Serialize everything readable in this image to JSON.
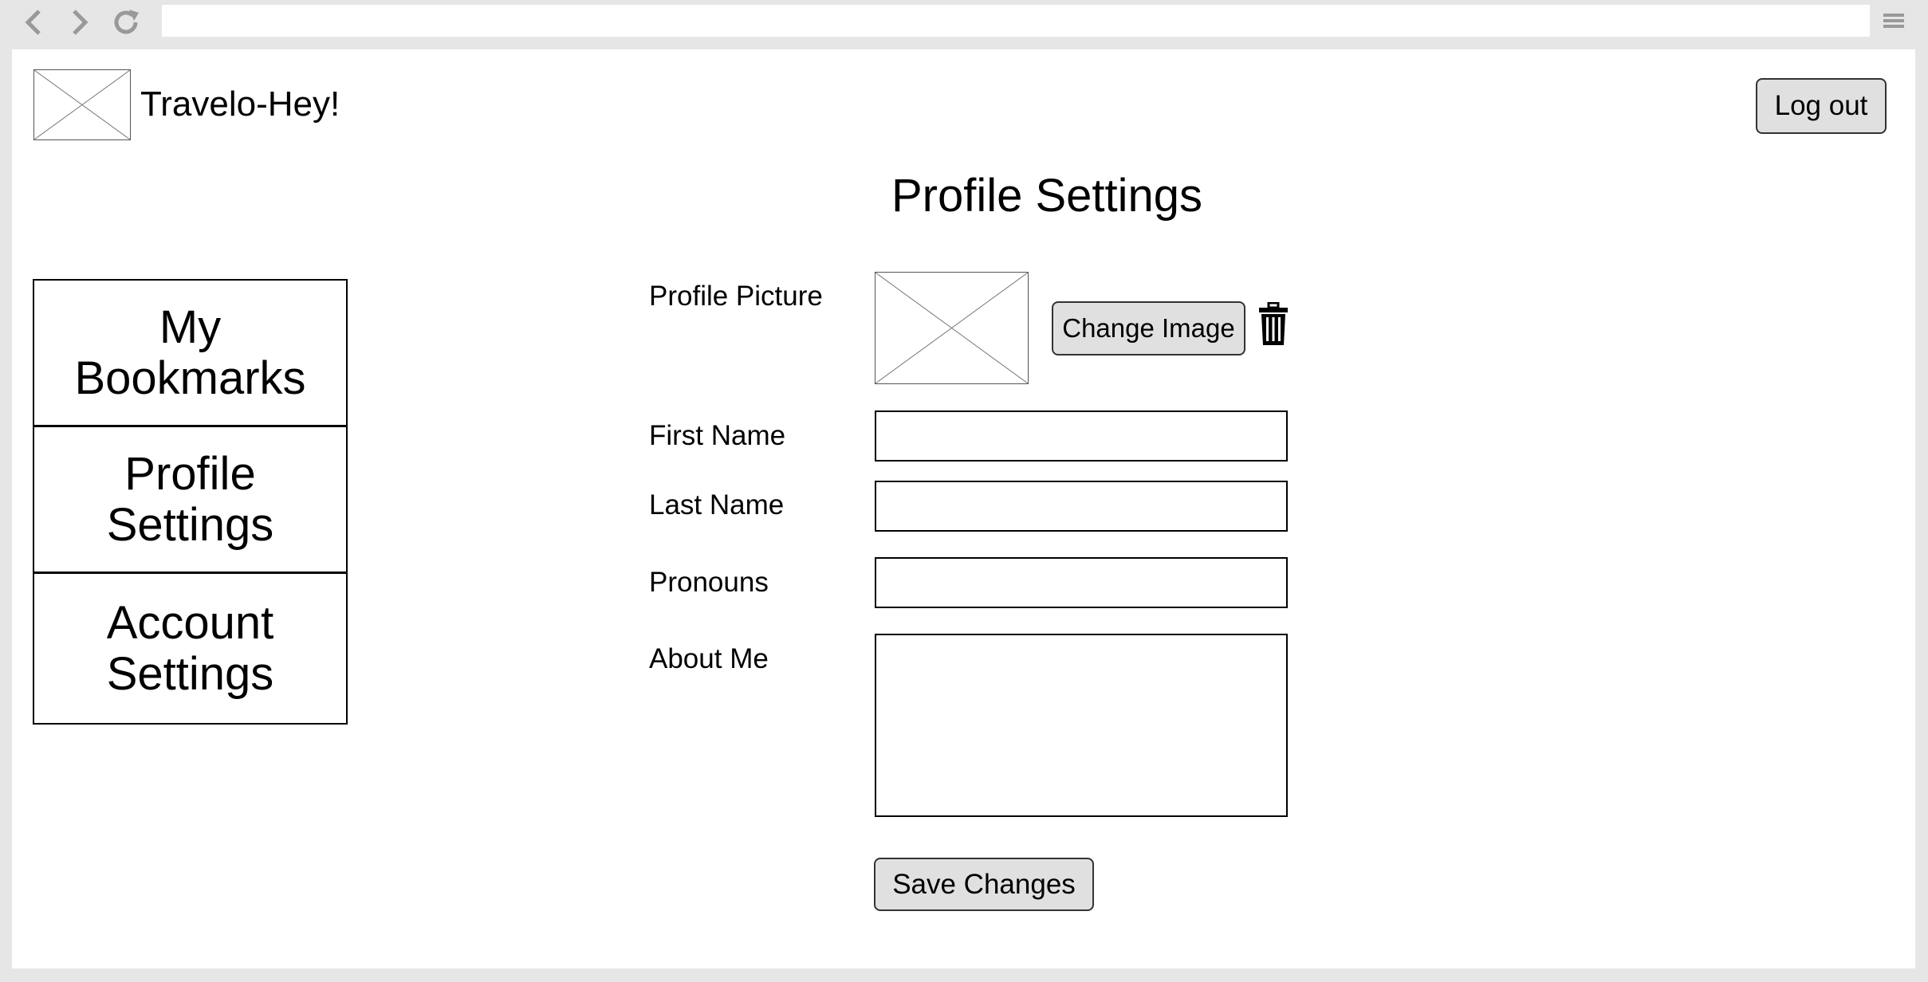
{
  "browser": {
    "back_icon": "chevron-left-icon",
    "forward_icon": "chevron-right-icon",
    "reload_icon": "reload-icon",
    "menu_icon": "hamburger-menu-icon",
    "address_value": ""
  },
  "header": {
    "brand_name": "Travelo-Hey!",
    "logout_label": "Log out"
  },
  "main": {
    "page_title": "Profile Settings"
  },
  "sidebar": {
    "items": [
      {
        "label": "My Bookmarks"
      },
      {
        "label": "Profile Settings"
      },
      {
        "label": "Account Settings"
      }
    ]
  },
  "form": {
    "profile_picture_label": "Profile Picture",
    "change_image_label": "Change Image",
    "delete_icon": "trash-icon",
    "first_name_label": "First Name",
    "first_name_value": "",
    "last_name_label": "Last Name",
    "last_name_value": "",
    "pronouns_label": "Pronouns",
    "pronouns_value": "",
    "about_me_label": "About Me",
    "about_me_value": "",
    "save_label": "Save Changes"
  },
  "colors": {
    "chrome_gray": "#e6e6e6",
    "button_fill": "#e0e0e0",
    "icon_gray": "#999999"
  }
}
